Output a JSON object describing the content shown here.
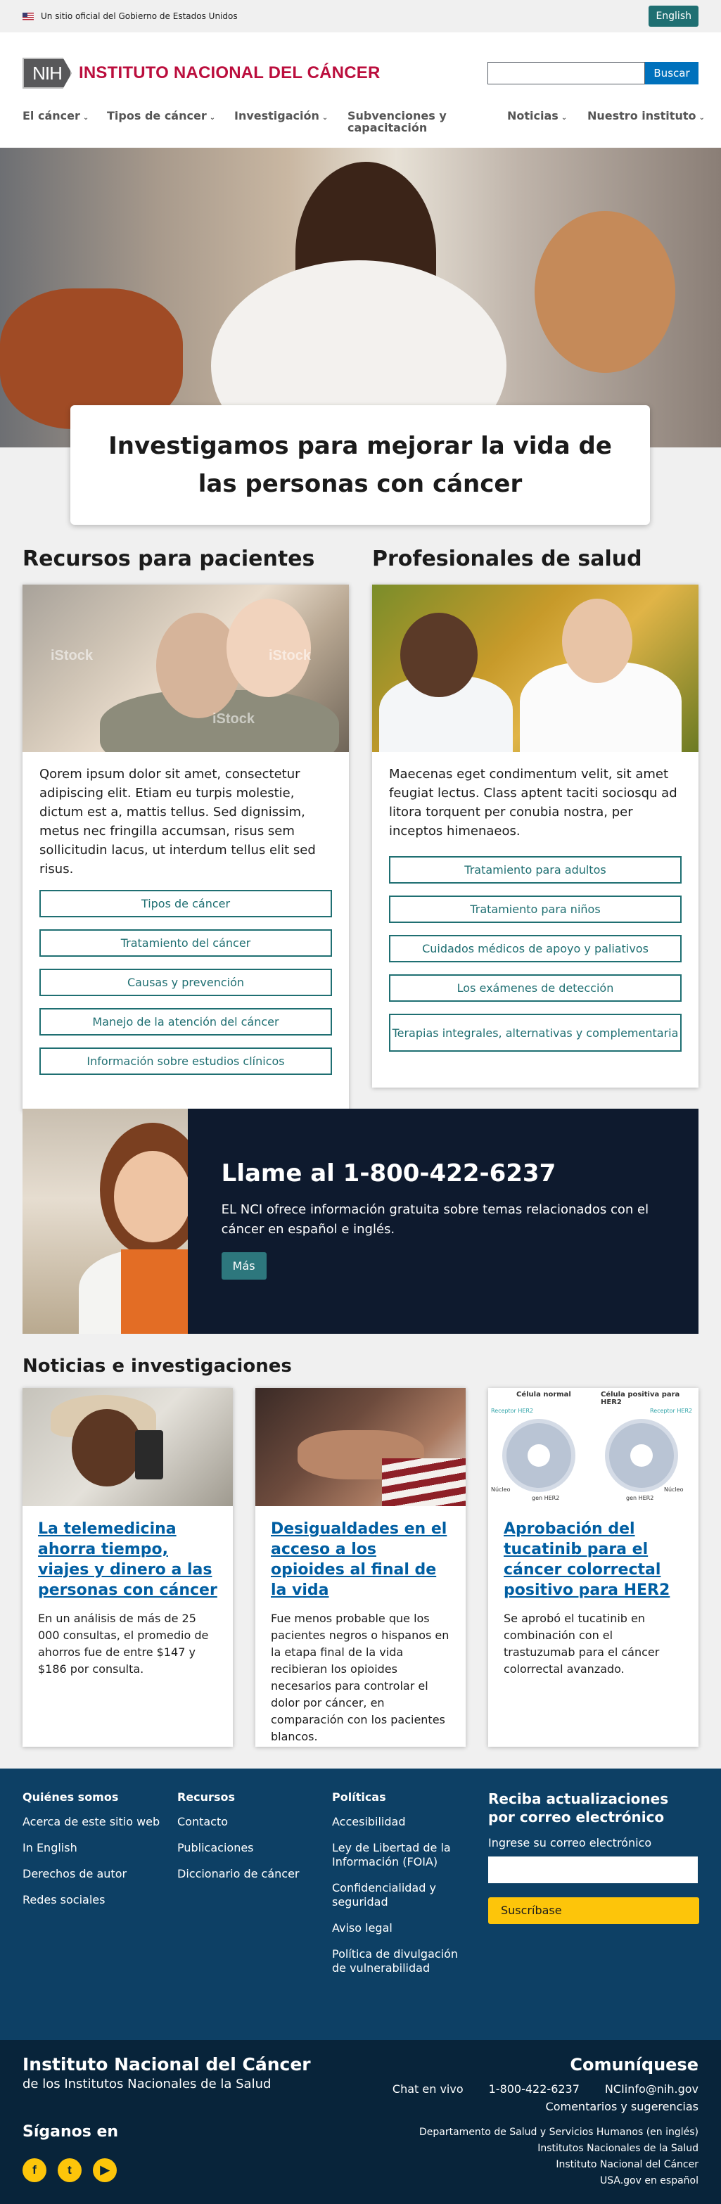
{
  "gov_banner": {
    "text": "Un sitio oficial del Gobierno de Estados Unidos",
    "language_button": "English"
  },
  "header": {
    "logo_abbr": "NIH",
    "logo_text": "INSTITUTO NACIONAL DEL CÁNCER",
    "search_placeholder": "",
    "search_button": "Buscar"
  },
  "nav": [
    {
      "label": "El cáncer"
    },
    {
      "label": "Tipos de cáncer"
    },
    {
      "label": "Investigación"
    },
    {
      "label": "Subvenciones y capacitación"
    },
    {
      "label": "Noticias"
    },
    {
      "label": "Nuestro instituto"
    }
  ],
  "hero": {
    "headline": "Investigamos para mejorar la vida de las personas con cáncer"
  },
  "patients": {
    "title": "Recursos para pacientes",
    "watermark": "iStock",
    "text": "Qorem ipsum dolor sit amet, consectetur adipiscing elit. Etiam eu turpis molestie, dictum est a, mattis tellus. Sed dignissim, metus nec fringilla accumsan, risus sem sollicitudin lacus, ut interdum tellus elit sed risus.",
    "links": [
      "Tipos de cáncer",
      "Tratamiento del cáncer",
      "Causas y prevención",
      "Manejo de la atención del cáncer",
      "Información sobre estudios clínicos"
    ]
  },
  "professionals": {
    "title": "Profesionales de salud",
    "text": "Maecenas eget condimentum velit, sit amet feugiat lectus. Class aptent taciti sociosqu ad litora torquent per conubia nostra, per inceptos himenaeos.",
    "links": [
      "Tratamiento para adultos",
      "Tratamiento para niños",
      "Cuidados médicos de apoyo y paliativos",
      "Los exámenes de detección",
      "Terapias integrales, alternativas y complementaria"
    ]
  },
  "call": {
    "title": "Llame al 1-800-422-6237",
    "text": "EL NCI ofrece información gratuita sobre temas relacionados con el cáncer en español e inglés.",
    "button": "Más"
  },
  "news": {
    "title": "Noticias e investigaciones",
    "items": [
      {
        "title": "La telemedicina ahorra tiempo, viajes y dinero a las personas con cáncer",
        "text": "En un análisis de más de 25 000 consultas, el promedio de ahorros fue de entre $147 y $186 por consulta."
      },
      {
        "title": "Desigualdades en el acceso a los opioides al final de la vida",
        "text": "Fue menos probable que los pacientes negros o hispanos en la etapa final de la vida recibieran los opioides necesarios para controlar el dolor por cáncer, en comparación con los pacientes blancos."
      },
      {
        "title": "Aprobación del tucatinib para el cáncer colorrectal positivo para HER2",
        "text": "Se aprobó el tucatinib en combinación con el trastuzumab para el cáncer colorrectal avanzado."
      }
    ],
    "figure": {
      "normal_cell": "Célula normal",
      "her2_cell": "Célula positiva para HER2",
      "receptor": "Receptor HER2",
      "nucleus": "Núcleo",
      "gene": "gen HER2"
    }
  },
  "footer": {
    "cols": [
      {
        "title": "Quiénes somos",
        "links": [
          "Acerca de este sitio web",
          "In English",
          "Derechos de autor",
          "Redes sociales"
        ]
      },
      {
        "title": "Recursos",
        "links": [
          "Contacto",
          "Publicaciones",
          "Diccionario de cáncer"
        ]
      },
      {
        "title": "Políticas",
        "links": [
          "Accesibilidad",
          "Ley de Libertad de la Información (FOIA)",
          "Confidencialidad y seguridad",
          "Aviso legal",
          "Política de divulgación de vulnerabilidad"
        ]
      }
    ],
    "subscribe": {
      "title": "Reciba actualizaciones por correo electrónico",
      "label": "Ingrese su correo electrónico",
      "button": "Suscríbase"
    }
  },
  "footer2": {
    "title": "Instituto Nacional del Cáncer",
    "subtitle": "de los Institutos Nacionales de la Salud",
    "follow": "Síganos en",
    "connect": "Comuníquese",
    "chat": "Chat en vivo",
    "phone": "1-800-422-6237",
    "email": "NCIinfo@nih.gov",
    "comments": "Comentarios y sugerencias",
    "links": [
      "Departamento de Salud y Servicios Humanos (en inglés)",
      "Institutos Nacionales de la Salud",
      "Instituto Nacional del Cáncer",
      "USA.gov en español"
    ],
    "social": [
      {
        "glyph": "f",
        "icon": "facebook-icon"
      },
      {
        "glyph": "t",
        "icon": "twitter-icon"
      },
      {
        "glyph": "▶",
        "icon": "youtube-icon"
      }
    ]
  }
}
